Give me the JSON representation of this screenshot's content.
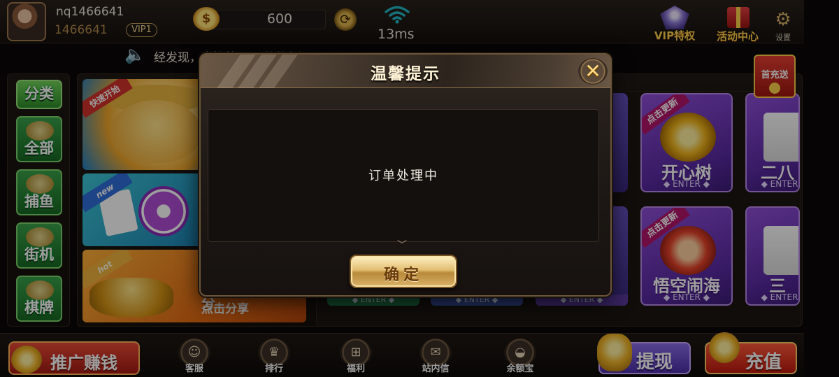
{
  "header": {
    "username": "nq1466641",
    "user_id": "1466641",
    "vip_level": "VIP1",
    "coin_balance": "600",
    "network_latency": "13ms",
    "vip_privilege_label": "VIP特权",
    "activity_center_label": "活动中心",
    "settings_label": "设置"
  },
  "marquee": {
    "text": "经发现，直接拉黑，谢谢合作"
  },
  "sidebar": {
    "items": [
      {
        "label": "分类"
      },
      {
        "label": "全部"
      },
      {
        "label": "捕鱼"
      },
      {
        "label": "街机"
      },
      {
        "label": "棋牌"
      }
    ]
  },
  "banners": {
    "fishing_tag": "快速开始",
    "poker_tag": "new",
    "share_tag": "hot",
    "share_title": "分",
    "share_subtitle": "点击分享"
  },
  "games": [
    {
      "name": "开心树",
      "tag": "点击更新",
      "enter": "◆ ENTER ◆"
    },
    {
      "name": "悟空闹海",
      "tag": "点击更新",
      "enter": "◆ ENTER ◆"
    },
    {
      "name": "二八",
      "enter": "◆ ENTER"
    },
    {
      "name": "三",
      "enter": "◆ ENTER"
    }
  ],
  "enter_strips": [
    "◆ ENTER ◆",
    "◆ ENTER ◆",
    "◆ ENTER ◆"
  ],
  "first_recharge_label": "首充送",
  "dialog": {
    "title": "温馨提示",
    "message": "订单处理中",
    "confirm_label": "确定"
  },
  "bottom_nav": {
    "promote_label": "推广赚钱",
    "items": [
      {
        "label": "客服"
      },
      {
        "label": "排行"
      },
      {
        "label": "福利"
      },
      {
        "label": "站内信"
      },
      {
        "label": "余额宝"
      }
    ],
    "withdraw_label": "提现",
    "recharge_label": "充值"
  },
  "colors": {
    "gold_accent": "#ffd34d",
    "dialog_border": "#6a5439",
    "category_green": "#2c8e2a"
  }
}
